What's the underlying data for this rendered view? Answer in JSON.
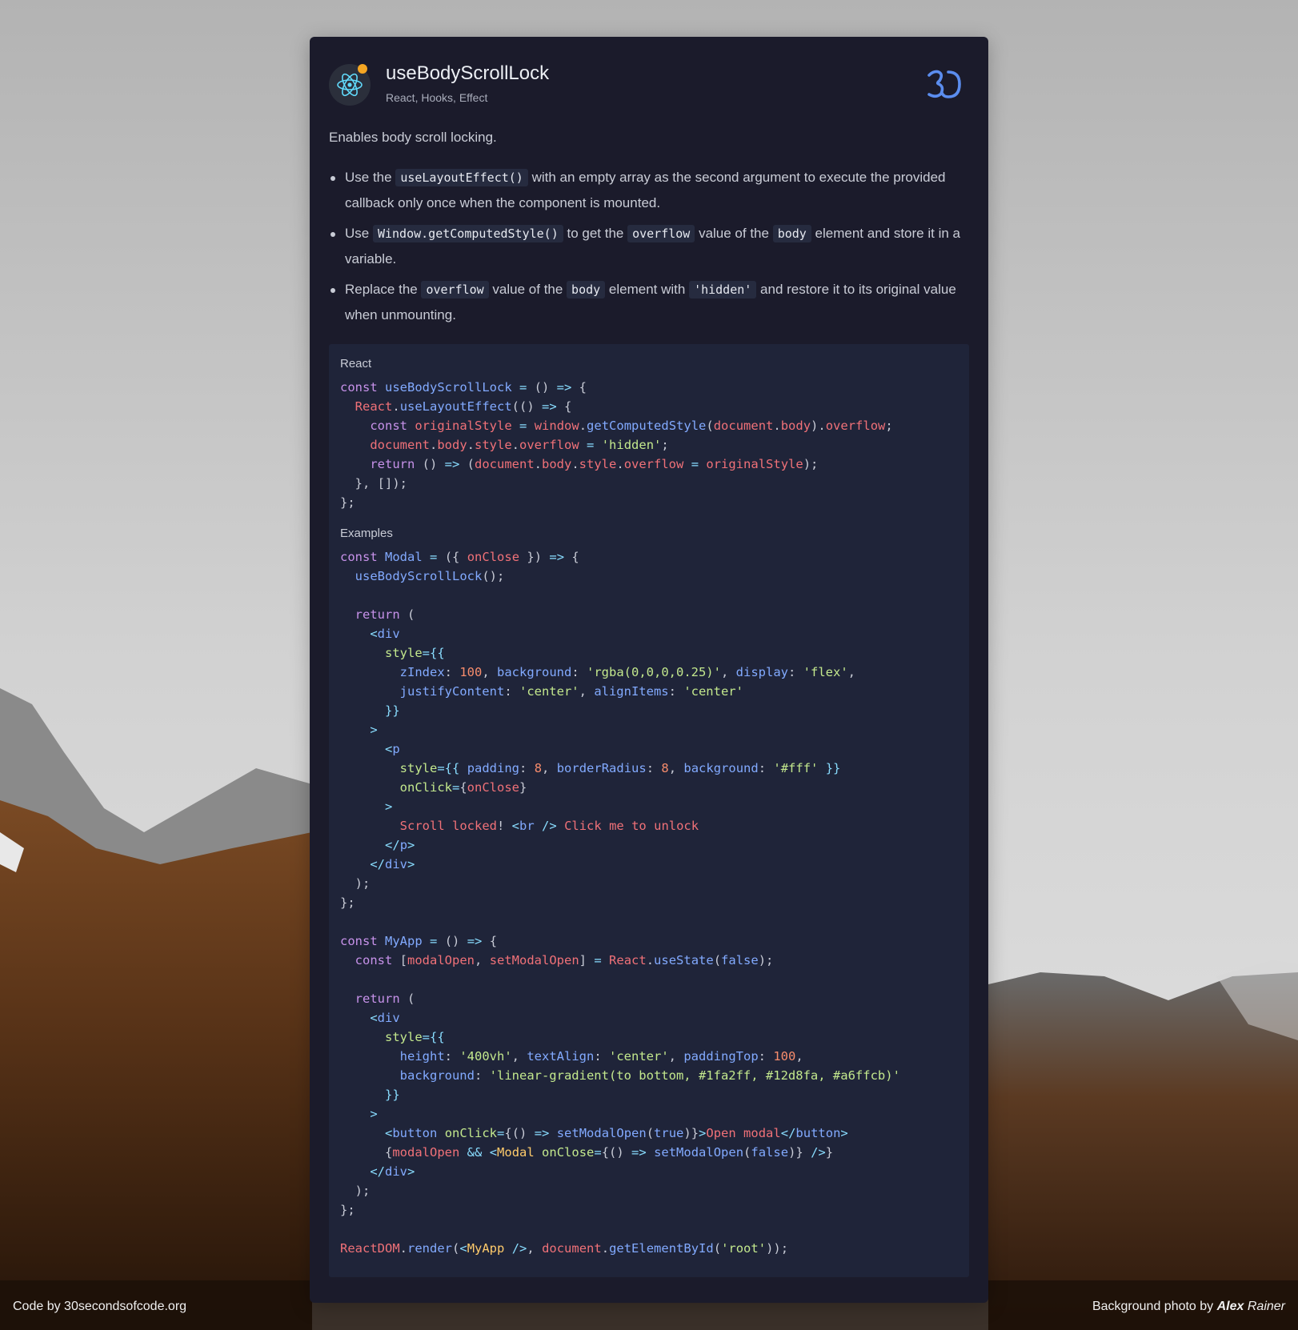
{
  "snippet": {
    "title": "useBodyScrollLock",
    "tags": "React, Hooks, Effect",
    "description": "Enables body scroll locking.",
    "bullets": [
      {
        "p1": "Use the ",
        "c1": "useLayoutEffect()",
        "p2": " with an empty array as the second argument to execute the provided callback only once when the component is mounted."
      },
      {
        "p1": "Use ",
        "c1": "Window.getComputedStyle()",
        "p2": " to get the ",
        "c2": "overflow",
        "p3": " value of the ",
        "c3": "body",
        "p4": " element and store it in a variable."
      },
      {
        "p1": "Replace the ",
        "c1": "overflow",
        "p2": " value of the ",
        "c2": "body",
        "p3": " element with ",
        "c3": "'hidden'",
        "p4": " and restore it to its original value when unmounting."
      }
    ],
    "code_label": "React",
    "examples_label": "Examples"
  },
  "code": {
    "hook": "const useBodyScrollLock = () => {\n  React.useLayoutEffect(() => {\n    const originalStyle = window.getComputedStyle(document.body).overflow;\n    document.body.style.overflow = 'hidden';\n    return () => (document.body.style.overflow = originalStyle);\n  }, []);\n};",
    "examples": "const Modal = ({ onClose }) => {\n  useBodyScrollLock();\n\n  return (\n    <div\n      style={{\n        zIndex: 100, background: 'rgba(0,0,0,0.25)', display: 'flex',\n        justifyContent: 'center', alignItems: 'center'\n      }}\n    >\n      <p\n        style={{ padding: 8, borderRadius: 8, background: '#fff' }}\n        onClick={onClose}\n      >\n        Scroll locked! <br /> Click me to unlock\n      </p>\n    </div>\n  );\n};\n\nconst MyApp = () => {\n  const [modalOpen, setModalOpen] = React.useState(false);\n\n  return (\n    <div\n      style={{\n        height: '400vh', textAlign: 'center', paddingTop: 100,\n        background: 'linear-gradient(to bottom, #1fa2ff, #12d8fa, #a6ffcb)'\n      }}\n    >\n      <button onClick={() => setModalOpen(true)}>Open modal</button>\n      {modalOpen && <Modal onClose={() => setModalOpen(false)} />}\n    </div>\n  );\n};\n\nReactDOM.render(<MyApp />, document.getElementById('root'));"
  },
  "footer": {
    "code_credit": "Code by 30secondsofcode.org",
    "photo_prefix": "Background photo by ",
    "photo_author_first": "Alex",
    "photo_author_last": " Rainer"
  },
  "icons": {
    "avatar": "react-atom-icon",
    "brand": "30-seconds-logo-icon",
    "avatar_badge_color": "#f5a623",
    "react_color": "#61dafb",
    "brand_color": "#5b8def"
  }
}
